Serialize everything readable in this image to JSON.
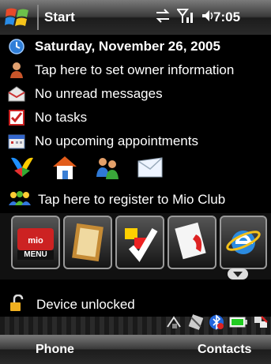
{
  "titlebar": {
    "app_name": "Start",
    "time": "7:05",
    "icons": [
      "windows-logo",
      "sync-icon",
      "signal-icon",
      "volume-icon"
    ]
  },
  "today": {
    "date": "Saturday, November 26, 2005",
    "owner": "Tap here to set owner information",
    "messages": "No unread messages",
    "tasks": "No tasks",
    "appointments": "No upcoming appointments",
    "quick_icons": [
      "msn-butterfly-icon",
      "home-icon",
      "contacts-people-icon",
      "envelope-icon"
    ],
    "club": "Tap here to register to Mio Club",
    "tiles": [
      {
        "name": "mio-menu-tile",
        "label": "MENU"
      },
      {
        "name": "picture-frame-tile",
        "label": ""
      },
      {
        "name": "checklist-tile",
        "label": ""
      },
      {
        "name": "phone-tile",
        "label": ""
      },
      {
        "name": "internet-explorer-tile",
        "label": ""
      }
    ],
    "device_status": "Device unlocked"
  },
  "tray_icons": [
    "wifi-icon",
    "card-icon",
    "bluetooth-icon",
    "battery-icon",
    "connectivity-icon"
  ],
  "softkeys": {
    "left": "Phone",
    "right": "Contacts"
  }
}
